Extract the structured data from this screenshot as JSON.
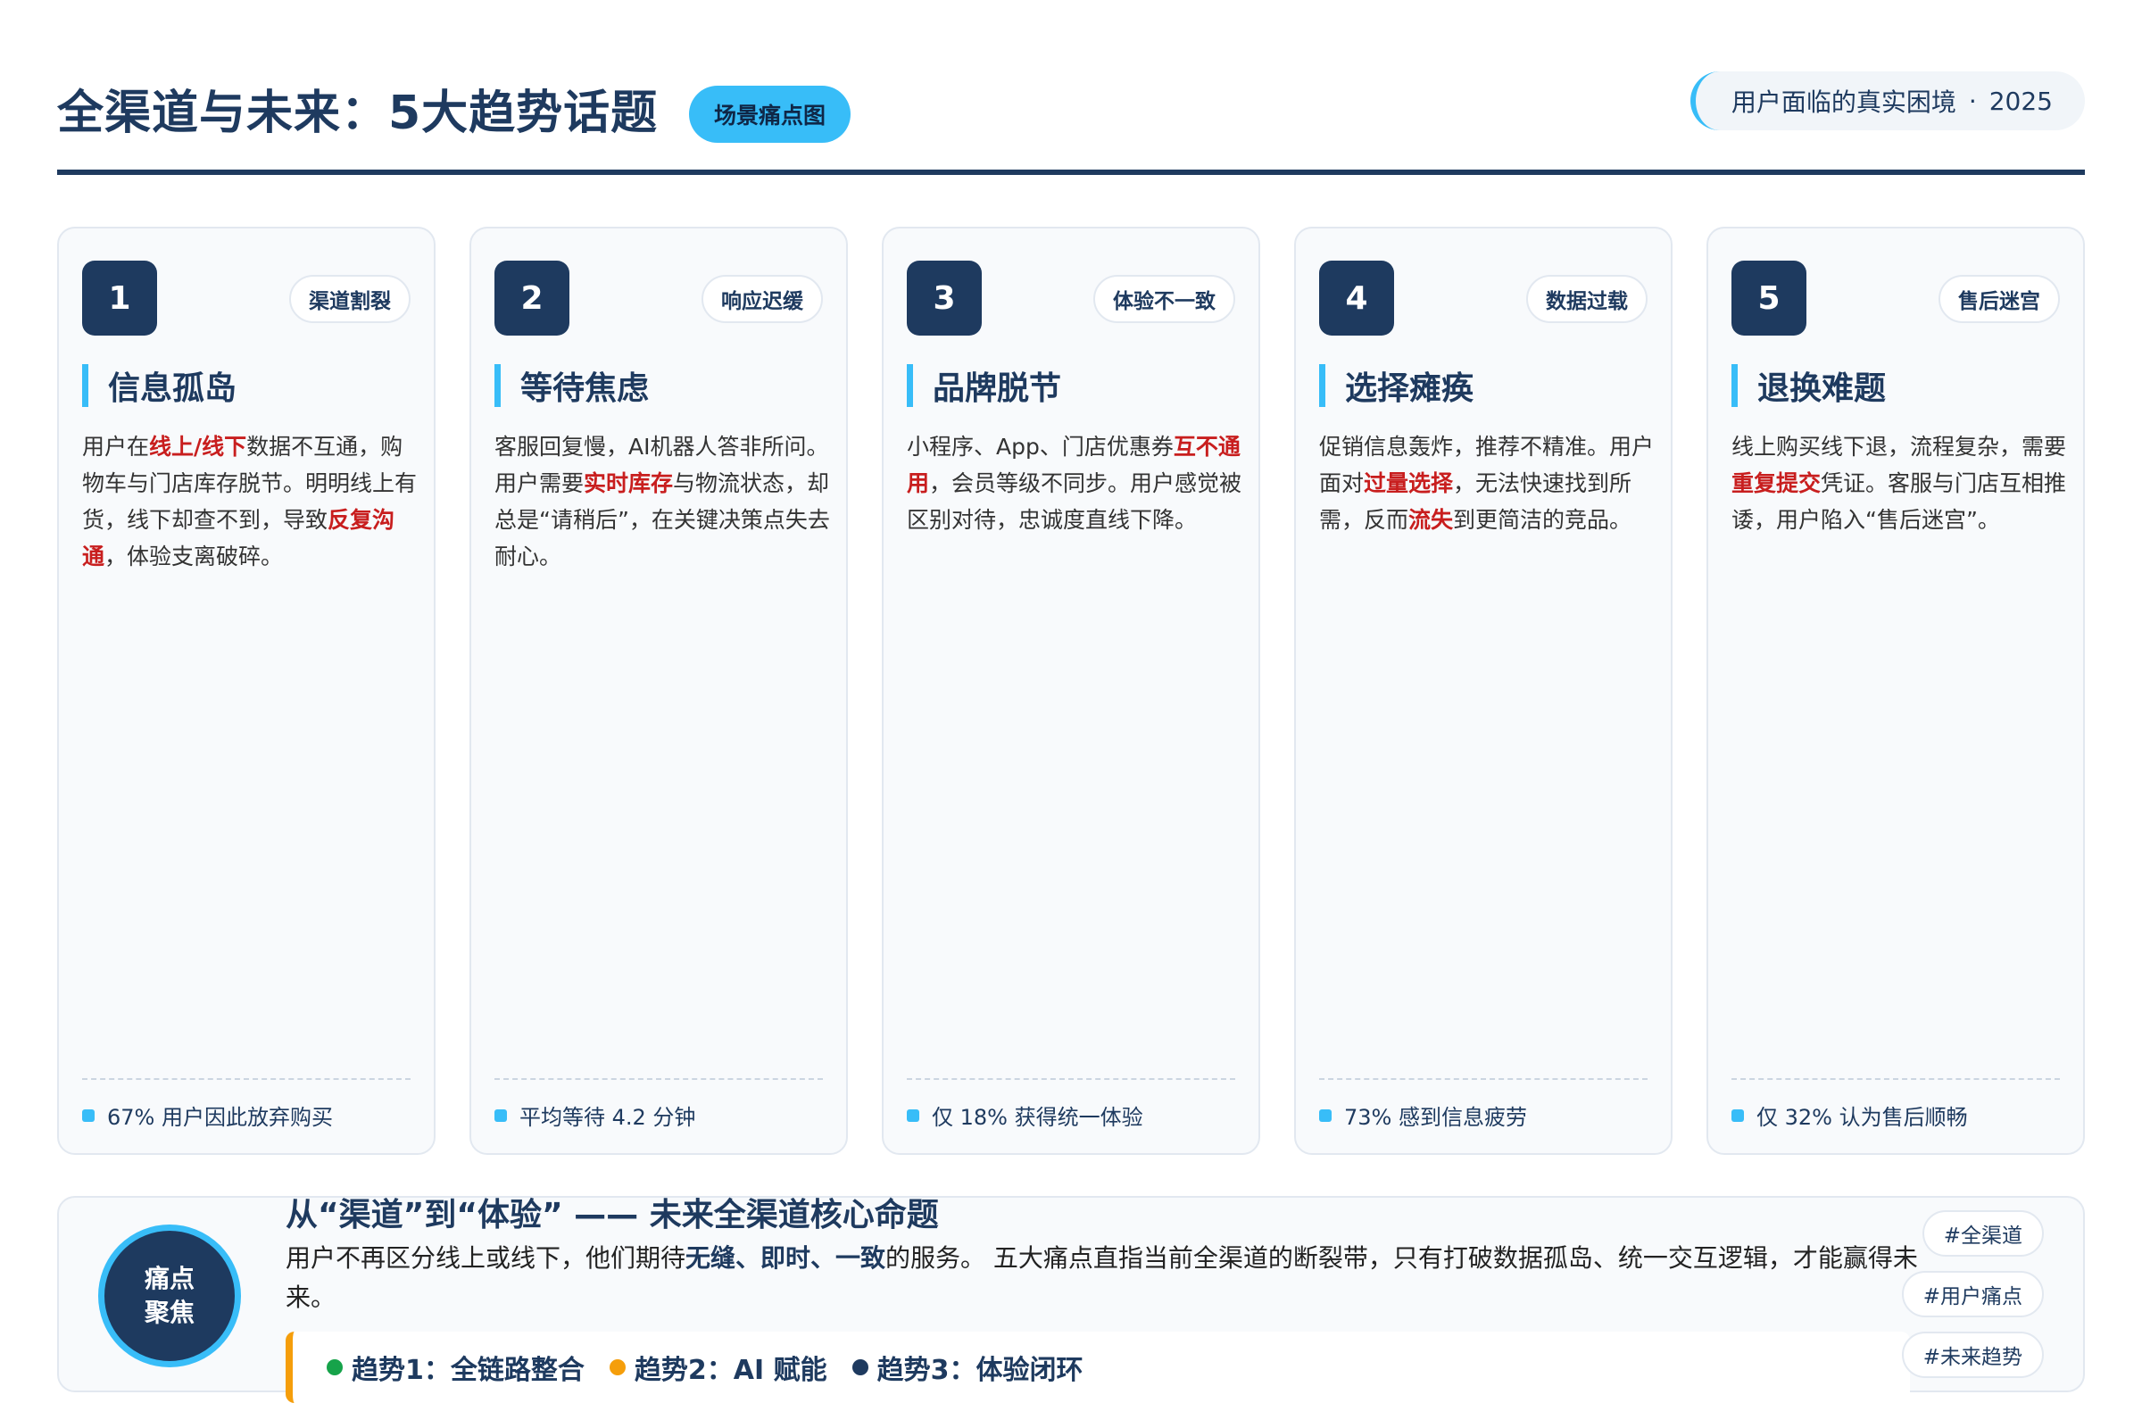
{
  "header": {
    "title": "全渠道与未来：5大趋势话题",
    "badge": "场景痛点图",
    "pill_text": "用户面临的真实困境",
    "pill_sep": "·",
    "pill_year": "2025"
  },
  "cards": [
    {
      "number": "1",
      "tag": "渠道割裂",
      "title": "信息孤岛",
      "body": [
        {
          "t": "用户在",
          "h": false
        },
        {
          "t": "线上/线下",
          "h": true
        },
        {
          "t": "数据不互通，购物车与门店库存脱节。明明线上有货，线下却查不到，导致",
          "h": false
        },
        {
          "t": "反复沟通",
          "h": true
        },
        {
          "t": "，体验支离破碎。",
          "h": false
        }
      ],
      "stat": "67% 用户因此放弃购买"
    },
    {
      "number": "2",
      "tag": "响应迟缓",
      "title": "等待焦虑",
      "body": [
        {
          "t": "客服回复慢，AI机器人答非所问。用户需要",
          "h": false
        },
        {
          "t": "实时库存",
          "h": true
        },
        {
          "t": "与物流状态，却总是“请稍后”，在关键决策点失去耐心。",
          "h": false
        }
      ],
      "stat": "平均等待 4.2 分钟"
    },
    {
      "number": "3",
      "tag": "体验不一致",
      "title": "品牌脱节",
      "body": [
        {
          "t": "小程序、App、门店优惠券",
          "h": false
        },
        {
          "t": "互不通用",
          "h": true
        },
        {
          "t": "，会员等级不同步。用户感觉被区别对待，忠诚度直线下降。",
          "h": false
        }
      ],
      "stat": "仅 18% 获得统一体验"
    },
    {
      "number": "4",
      "tag": "数据过载",
      "title": "选择瘫痪",
      "body": [
        {
          "t": "促销信息轰炸，推荐不精准。用户面对",
          "h": false
        },
        {
          "t": "过量选择",
          "h": true
        },
        {
          "t": "，无法快速找到所需，反而",
          "h": false
        },
        {
          "t": "流失",
          "h": true
        },
        {
          "t": "到更简洁的竞品。",
          "h": false
        }
      ],
      "stat": "73% 感到信息疲劳"
    },
    {
      "number": "5",
      "tag": "售后迷宫",
      "title": "退换难题",
      "body": [
        {
          "t": "线上购买线下退，流程复杂，需要",
          "h": false
        },
        {
          "t": "重复提交",
          "h": true
        },
        {
          "t": "凭证。客服与门店互相推诿，用户陷入“售后迷宫”。",
          "h": false
        }
      ],
      "stat": "仅 32% 认为售后顺畅"
    }
  ],
  "bottom": {
    "circle_line1": "痛点",
    "circle_line2": "聚焦",
    "heading": "从“渠道”到“体验” —— 未来全渠道核心命题",
    "text_before": "用户不再区分线上或线下，他们期待",
    "text_strong": "无缝、即时、一致",
    "text_after": "的服务。 五大痛点直指当前全渠道的断裂带，只有打破数据孤岛、统一交互逻辑，才能赢得未来。",
    "trends": [
      {
        "label": "趋势1：全链路整合",
        "color": "#16a34a"
      },
      {
        "label": "趋势2：AI 赋能",
        "color": "#f59e0b"
      },
      {
        "label": "趋势3：体验闭环",
        "color": "#1e3a5f"
      }
    ],
    "chips": [
      "#全渠道",
      "#用户痛点",
      "#未来趋势"
    ]
  }
}
